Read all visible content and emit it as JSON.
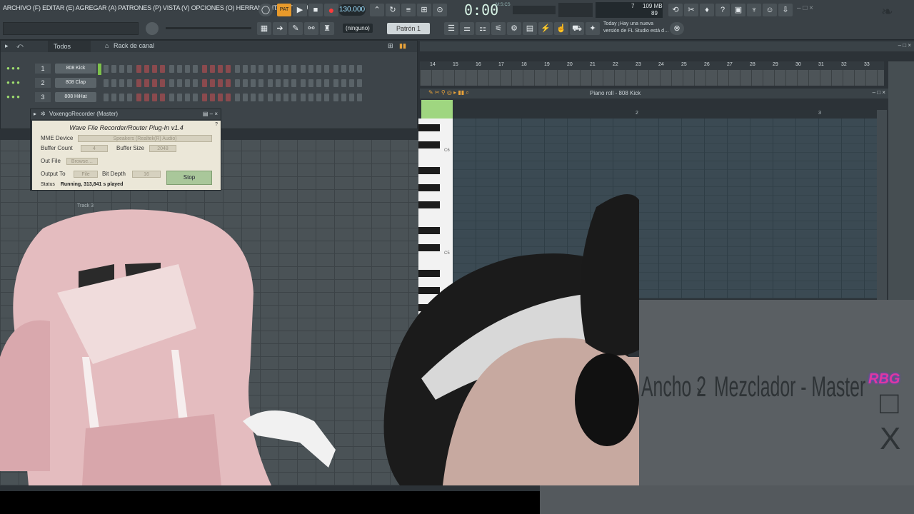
{
  "menu": "ARCHIVO (F) EDITAR (E) AGREGAR (A) PATRONES (P) VISTA (V) OPCIONES (O) HERRAMIENTAS (T) AYUDA",
  "transport": {
    "tempo": "130.000",
    "time": "0:00",
    "time_sub": "00",
    "msc_label": "M:S:CS"
  },
  "cpu": {
    "value1": "7",
    "mem": "109 MB",
    "value2": "89"
  },
  "hint": "(ninguno)",
  "pattern": "Patrón 1",
  "news": {
    "line1": "Today  ¡Hay una nueva",
    "line2": "versión de FL Studio está d…"
  },
  "rack": {
    "filter": "Todos",
    "title": "Rack de canal",
    "channels": [
      {
        "num": "1",
        "name": "808 Kick"
      },
      {
        "num": "2",
        "name": "808 Clap"
      },
      {
        "num": "3",
        "name": "808 HiHat"
      }
    ]
  },
  "recorder": {
    "window_title": "VoxengoRecorder (Master)",
    "heading": "Wave File Recorder/Router Plug-In v1.4",
    "mme_label": "MME Device",
    "mme_value": "Speakers (Realtek(R) Audio)",
    "buffer_count_label": "Buffer Count",
    "buffer_count_value": "4",
    "buffer_size_label": "Buffer Size",
    "buffer_size_value": "2048",
    "out_file_label": "Out File",
    "out_file_value": "Browse…",
    "output_to_label": "Output To",
    "output_to_value": "File",
    "bit_depth_label": "Bit Depth",
    "bit_depth_value": "16",
    "stop_label": "Stop",
    "status_label": "Status",
    "status_value": "Running, 313,841 s played"
  },
  "playlist": {
    "track_label": "Track 3",
    "ruler": [
      "14",
      "15",
      "16",
      "17",
      "18",
      "19",
      "20",
      "21",
      "22",
      "23",
      "24",
      "25",
      "26",
      "27",
      "28",
      "29",
      "30",
      "31",
      "32",
      "33"
    ]
  },
  "piano_roll": {
    "title": "Piano roll - 808 Kick",
    "bars": [
      "2",
      "3"
    ],
    "key_labels": [
      "C6",
      "C5"
    ]
  },
  "overlay": {
    "mixer_left": "Ancho 2",
    "mixer_right": "Mezclador - Master",
    "logo": "RBG",
    "window_controls": "□ X"
  }
}
